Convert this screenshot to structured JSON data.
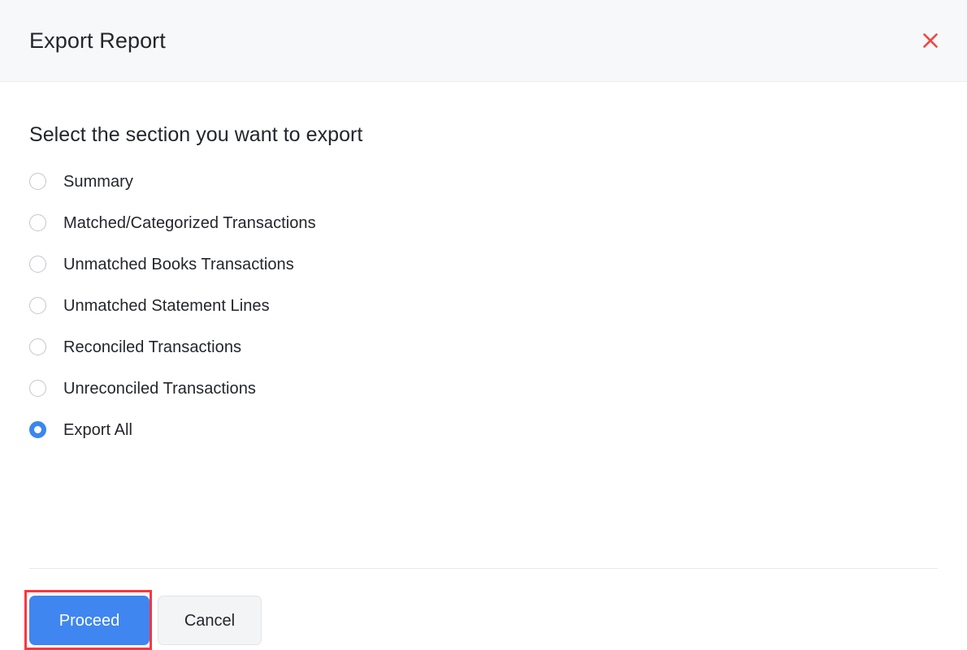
{
  "dialog": {
    "title": "Export Report",
    "close_icon": "close-x-icon",
    "close_icon_color": "#f4453f",
    "header_bg": "#f7f8fa"
  },
  "main": {
    "heading": "Select the section you want to export",
    "options": [
      {
        "label": "Summary",
        "selected": false
      },
      {
        "label": "Matched/Categorized Transactions",
        "selected": false
      },
      {
        "label": "Unmatched Books Transactions",
        "selected": false
      },
      {
        "label": "Unmatched Statement Lines",
        "selected": false
      },
      {
        "label": "Reconciled Transactions",
        "selected": false
      },
      {
        "label": "Unreconciled Transactions",
        "selected": false
      },
      {
        "label": "Export All",
        "selected": true
      }
    ]
  },
  "footer": {
    "proceed_label": "Proceed",
    "cancel_label": "Cancel",
    "primary_color": "#3f86f0",
    "secondary_color": "#f3f4f6"
  },
  "annotation": {
    "target": "Proceed",
    "color": "#fb3640"
  }
}
